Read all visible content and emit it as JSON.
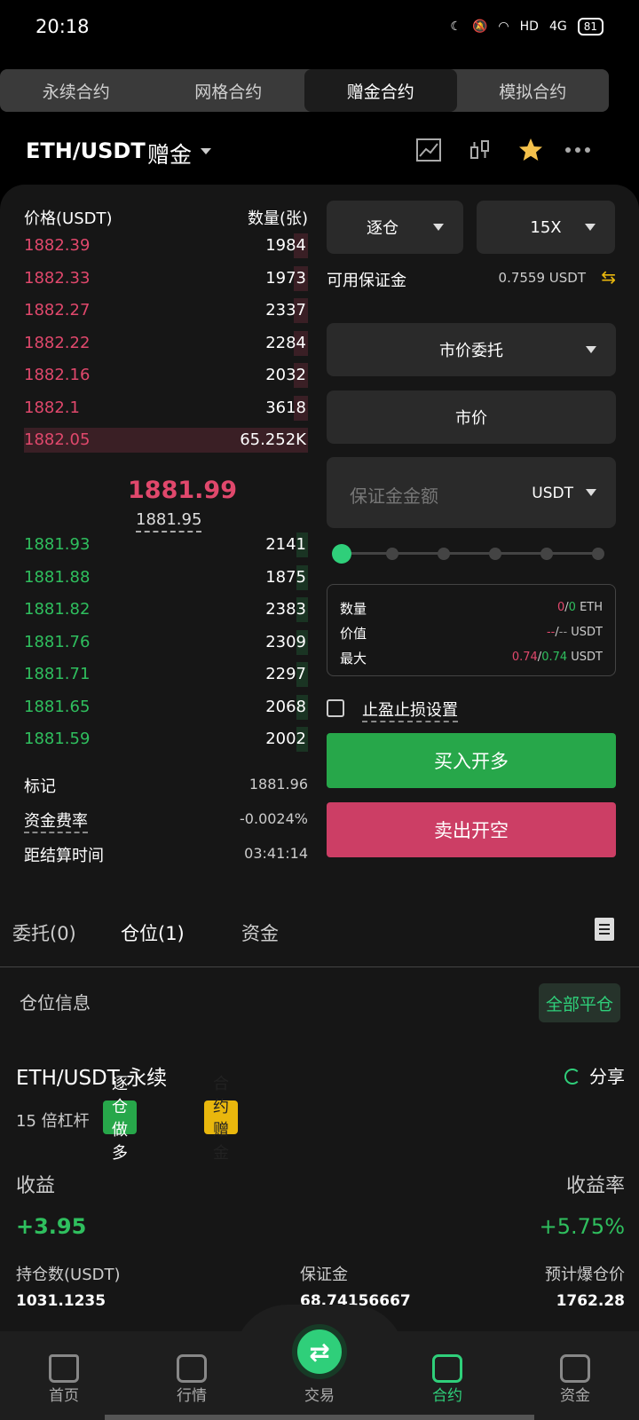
{
  "status_bar": {
    "time": "20:18",
    "network": "4G",
    "hd": "HD",
    "battery": "81"
  },
  "contract_tabs": [
    "永续合约",
    "网格合约",
    "赠金合约",
    "模拟合约"
  ],
  "header": {
    "pair": "ETH/USDT",
    "mode": "赠金"
  },
  "orderbook": {
    "price_header": "价格(USDT)",
    "qty_header": "数量(张)",
    "asks": [
      {
        "price": "1882.39",
        "qty": "1984",
        "depth": 0.05
      },
      {
        "price": "1882.33",
        "qty": "1973",
        "depth": 0.05
      },
      {
        "price": "1882.27",
        "qty": "2337",
        "depth": 0.05
      },
      {
        "price": "1882.22",
        "qty": "2284",
        "depth": 0.05
      },
      {
        "price": "1882.16",
        "qty": "2032",
        "depth": 0.05
      },
      {
        "price": "1882.1",
        "qty": "3618",
        "depth": 0.05
      },
      {
        "price": "1882.05",
        "qty": "65.252K",
        "depth": 1.0
      }
    ],
    "last_price": "1881.99",
    "mark_price": "1881.95",
    "bids": [
      {
        "price": "1881.93",
        "qty": "2141",
        "depth": 0.04
      },
      {
        "price": "1881.88",
        "qty": "1875",
        "depth": 0.04
      },
      {
        "price": "1881.82",
        "qty": "2383",
        "depth": 0.04
      },
      {
        "price": "1881.76",
        "qty": "2309",
        "depth": 0.04
      },
      {
        "price": "1881.71",
        "qty": "2297",
        "depth": 0.04
      },
      {
        "price": "1881.65",
        "qty": "2068",
        "depth": 0.04
      },
      {
        "price": "1881.59",
        "qty": "2002",
        "depth": 0.04
      }
    ]
  },
  "market_info": {
    "mark_label": "标记",
    "mark_value": "1881.96",
    "funding_label": "资金费率",
    "funding_value": "-0.0024%",
    "settle_label": "距结算时间",
    "settle_value": "03:41:14"
  },
  "order_form": {
    "margin_mode": "逐仓",
    "leverage": "15X",
    "available_label": "可用保证金",
    "available_value": "0.7559 USDT",
    "order_type": "市价委托",
    "price_field": "市价",
    "amount_placeholder": "保证金金额",
    "amount_unit": "USDT",
    "slider_percent": 0,
    "summary": {
      "qty_label": "数量",
      "qty_a": "0",
      "qty_b": "0",
      "qty_unit": "ETH",
      "value_label": "价值",
      "value_a": "--",
      "value_b": "--",
      "value_unit": "USDT",
      "max_label": "最大",
      "max_a": "0.74",
      "max_b": "0.74",
      "max_unit": "USDT"
    },
    "tpsl_label": "止盈止损设置",
    "buy_label": "买入开多",
    "sell_label": "卖出开空"
  },
  "sub_tabs": {
    "orders": "委托(0)",
    "positions": "仓位(1)",
    "assets": "资金"
  },
  "position": {
    "section_title": "仓位信息",
    "close_all": "全部平仓",
    "symbol": "ETH/USDT 永续",
    "share": "分享",
    "leverage_text": "15 倍杠杆",
    "badge_side": "逐仓做多",
    "badge_bonus": "合约赠金",
    "pnl_label": "收益",
    "pnl_value": "+3.95",
    "roe_label": "收益率",
    "roe_value": "+5.75%",
    "size_label": "持仓数(USDT)",
    "size_value": "1031.1235",
    "margin_label": "保证金",
    "margin_value": "68.74156667",
    "liq_label": "预计爆仓价",
    "liq_value": "1762.28"
  },
  "bottom_nav": [
    "首页",
    "行情",
    "交易",
    "合约",
    "资金"
  ],
  "colors": {
    "bid": "#2fbf5e",
    "ask": "#e0486c",
    "accent": "#2fcf7a",
    "bonus": "#e9b70d"
  }
}
